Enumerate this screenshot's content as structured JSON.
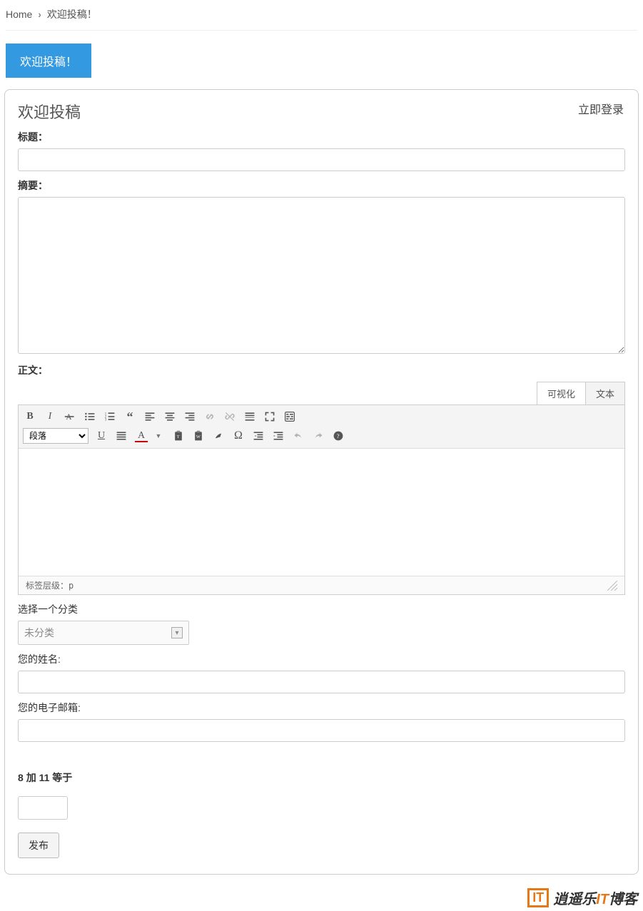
{
  "breadcrumb": {
    "home": "Home",
    "current": "欢迎投稿！"
  },
  "titleButton": "欢迎投稿！",
  "panel": {
    "title": "欢迎投稿",
    "loginLink": "立即登录",
    "labels": {
      "title": "标题：",
      "summary": "摘要：",
      "content": "正文：",
      "category": "选择一个分类",
      "name": "您的姓名:",
      "email": "您的电子邮箱:"
    },
    "editor": {
      "tabs": {
        "visual": "可视化",
        "text": "文本"
      },
      "paragraphSelect": "段落",
      "statusPrefix": "标签层级：",
      "statusTag": "p"
    },
    "category": {
      "selected": "未分类"
    },
    "captcha": {
      "a": "8",
      "op": "加",
      "b": "11",
      "suffix": "等于"
    },
    "submit": "发布"
  },
  "watermark": {
    "logo": "IT",
    "text1": "逍遥乐",
    "text2": "IT",
    "text3": "博客"
  }
}
